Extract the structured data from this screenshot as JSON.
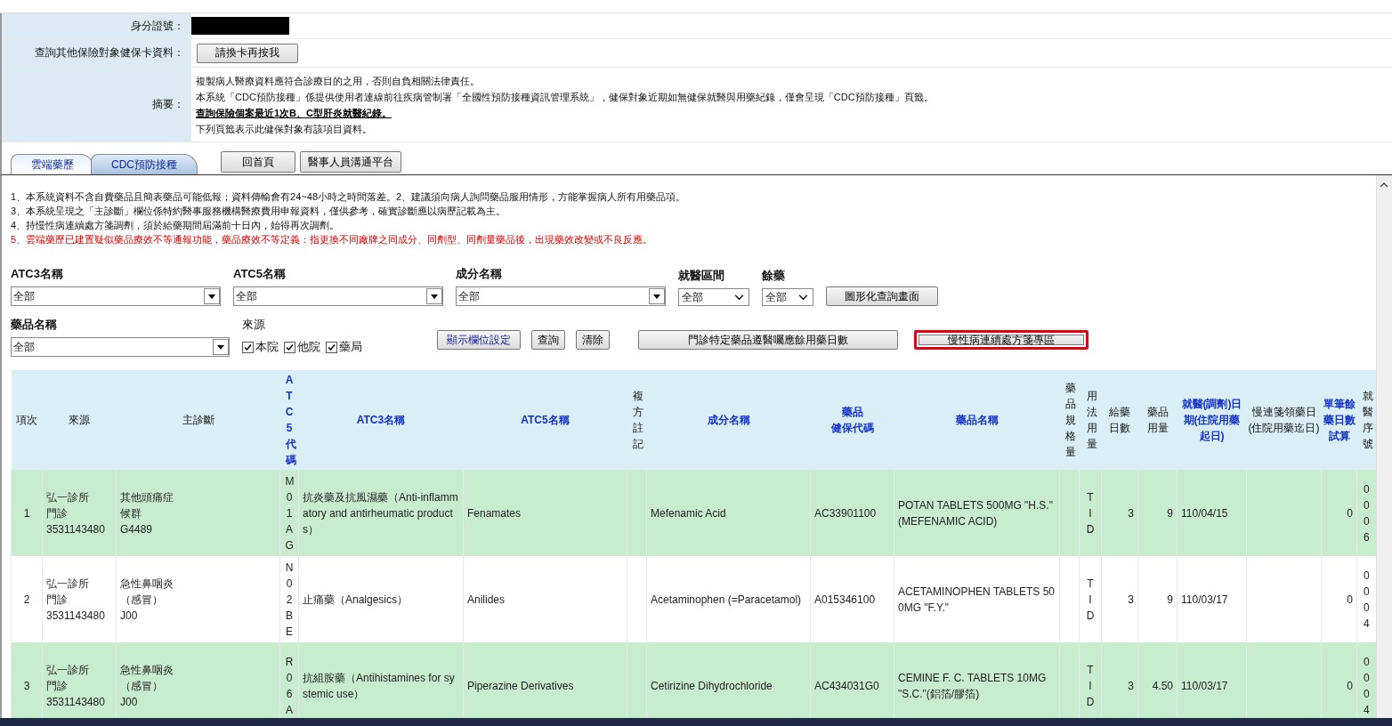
{
  "identity": {
    "label": "身分證號：",
    "masked": true
  },
  "other_insurance": {
    "label": "查詢其他保險對象健保卡資料：",
    "button": "請換卡再按我"
  },
  "summary": {
    "label": "摘要：",
    "lines": [
      {
        "kind": "text",
        "text": "複製病人醫療資料應符合診療目的之用，否則自負相關法律責任。"
      },
      {
        "kind": "text",
        "text": "本系統「CDC預防接種」係提供使用者連線前往疾病管制署「全國性預防接種資訊管理系統」，健保對象近期如無健保就醫與用藥紀錄，僅會呈現「CDC預防接種」頁籤。"
      },
      {
        "kind": "link",
        "text": "查詢保險個案最近1次B、C型肝炎就醫紀錄。"
      },
      {
        "kind": "text",
        "text": "下列頁籤表示此健保對象有該項目資料。"
      }
    ]
  },
  "tabs": [
    {
      "label": "雲端藥歷",
      "selected": true
    },
    {
      "label": "CDC預防接種",
      "selected": false
    }
  ],
  "nav_buttons": [
    "回首頁",
    "醫事人員溝通平台"
  ],
  "notices": [
    {
      "warning": false,
      "text": "1、本系統資料不含自費藥品且簡表藥品可能低報；資料傳輸會有24~48小時之時間落差。2、建議須向病人詢問藥品服用情形，方能掌握病人所有用藥品項。"
    },
    {
      "warning": false,
      "text": "3、本系統呈現之「主診斷」欄位係特約醫事服務機構醫療費用申報資料，僅供參考，確實診斷應以病歷記載為主。"
    },
    {
      "warning": false,
      "text": "4、持慢性病連續處方箋調劑，須於給藥期間屆滿前十日內，始得再次調劑。"
    },
    {
      "warning": true,
      "text": "5、雲端藥歷已建置疑似藥品療效不等通報功能，藥品療效不等定義：指更換不同廠牌之同成分、同劑型、同劑量藥品後，出現藥效改變或不良反應。"
    }
  ],
  "filters_row1": [
    {
      "kind": "combo",
      "label": "ATC3名稱",
      "value": "全部"
    },
    {
      "kind": "combo",
      "label": "ATC5名稱",
      "value": "全部"
    },
    {
      "kind": "combo",
      "label": "成分名稱",
      "value": "全部"
    },
    {
      "kind": "select",
      "label": "就醫區間",
      "value": "全部"
    },
    {
      "kind": "select",
      "label": "餘藥",
      "value": "全部"
    }
  ],
  "chart_button": "圖形化查詢畫面",
  "drug_filter": {
    "label": "藥品名稱",
    "value": "全部"
  },
  "source_filter": {
    "label": "來源",
    "options": [
      {
        "label": "本院",
        "checked": true
      },
      {
        "label": "他院",
        "checked": true
      },
      {
        "label": "藥局",
        "checked": true
      }
    ]
  },
  "action_buttons": [
    {
      "label": "顯示欄位設定",
      "highlighted": false,
      "kind": "settings"
    },
    {
      "label": "查詢",
      "highlighted": false,
      "kind": "plain"
    },
    {
      "label": "清除",
      "highlighted": false,
      "kind": "plain"
    },
    {
      "label": "門診特定藥品遵醫囑應餘用藥日數",
      "highlighted": false,
      "kind": "plain"
    },
    {
      "label": "慢性病連續處方箋專區",
      "highlighted": true,
      "kind": "plain"
    }
  ],
  "table": {
    "columns": [
      {
        "label": "項次",
        "sortable": false
      },
      {
        "label": "來源",
        "sortable": false
      },
      {
        "label": "主診斷",
        "sortable": false
      },
      {
        "label": "ATC5代碼",
        "sortable": true
      },
      {
        "label": "ATC3名稱",
        "sortable": true
      },
      {
        "label": "ATC5名稱",
        "sortable": true
      },
      {
        "label": "複方註記",
        "sortable": false
      },
      {
        "label": "成分名稱",
        "sortable": true
      },
      {
        "label": [
          "藥品",
          "健保代碼"
        ],
        "sortable": true
      },
      {
        "label": "藥品名稱",
        "sortable": true
      },
      {
        "label": "藥品規格量",
        "sortable": false
      },
      {
        "label": "用法用量",
        "sortable": false
      },
      {
        "label": "給藥日數",
        "sortable": false
      },
      {
        "label": "藥品用量",
        "sortable": false
      },
      {
        "label": "就醫(調劑)日期(住院用藥起日)",
        "sortable": true
      },
      {
        "label": "慢連箋領藥日(住院用藥迄日)",
        "sortable": false
      },
      {
        "label": "單筆餘藥日數試算",
        "sortable": true
      },
      {
        "label": "就醫序號",
        "sortable": false
      }
    ],
    "rows": [
      {
        "highlighted": true,
        "cells": [
          "1",
          [
            "弘一診所",
            "門診",
            "3531143480"
          ],
          [
            "其他頭痛症候群",
            "G4489"
          ],
          "M01AG",
          "抗炎藥及抗風濕藥（Anti-inflammatory and antirheumatic products）",
          "Fenamates",
          null,
          "Mefenamic Acid",
          "AC33901100",
          "POTAN TABLETS 500MG \"H.S.\" (MEFENAMIC ACID)",
          null,
          "TID",
          "3",
          "9",
          "110/04/15",
          null,
          "0",
          "0006"
        ]
      },
      {
        "highlighted": false,
        "cells": [
          "2",
          [
            "弘一診所",
            "門診",
            "3531143480"
          ],
          [
            "急性鼻咽炎（感冒）",
            "J00"
          ],
          "N02BE",
          "止痛藥（Analgesics）",
          "Anilides",
          null,
          "Acetaminophen (=Paracetamol)",
          "A015346100",
          "ACETAMINOPHEN TABLETS 500MG \"F.Y.\"",
          null,
          "TID",
          "3",
          "9",
          "110/03/17",
          null,
          "0",
          "0004"
        ]
      },
      {
        "highlighted": true,
        "cells": [
          "3",
          [
            "弘一診所",
            "門診",
            "3531143480"
          ],
          [
            "急性鼻咽炎（感冒）",
            "J00"
          ],
          "R06A",
          "抗組胺藥（Antihistamines for systemic use）",
          "Piperazine Derivatives",
          null,
          "Cetirizine Dihydrochloride",
          "AC434031G0",
          "CEMINE F. C. TABLETS 10MG \"S.C.\"(鋁箔/膠箔)",
          null,
          "TID",
          "3",
          "4.50",
          "110/03/17",
          null,
          "0",
          "0004"
        ]
      }
    ]
  }
}
